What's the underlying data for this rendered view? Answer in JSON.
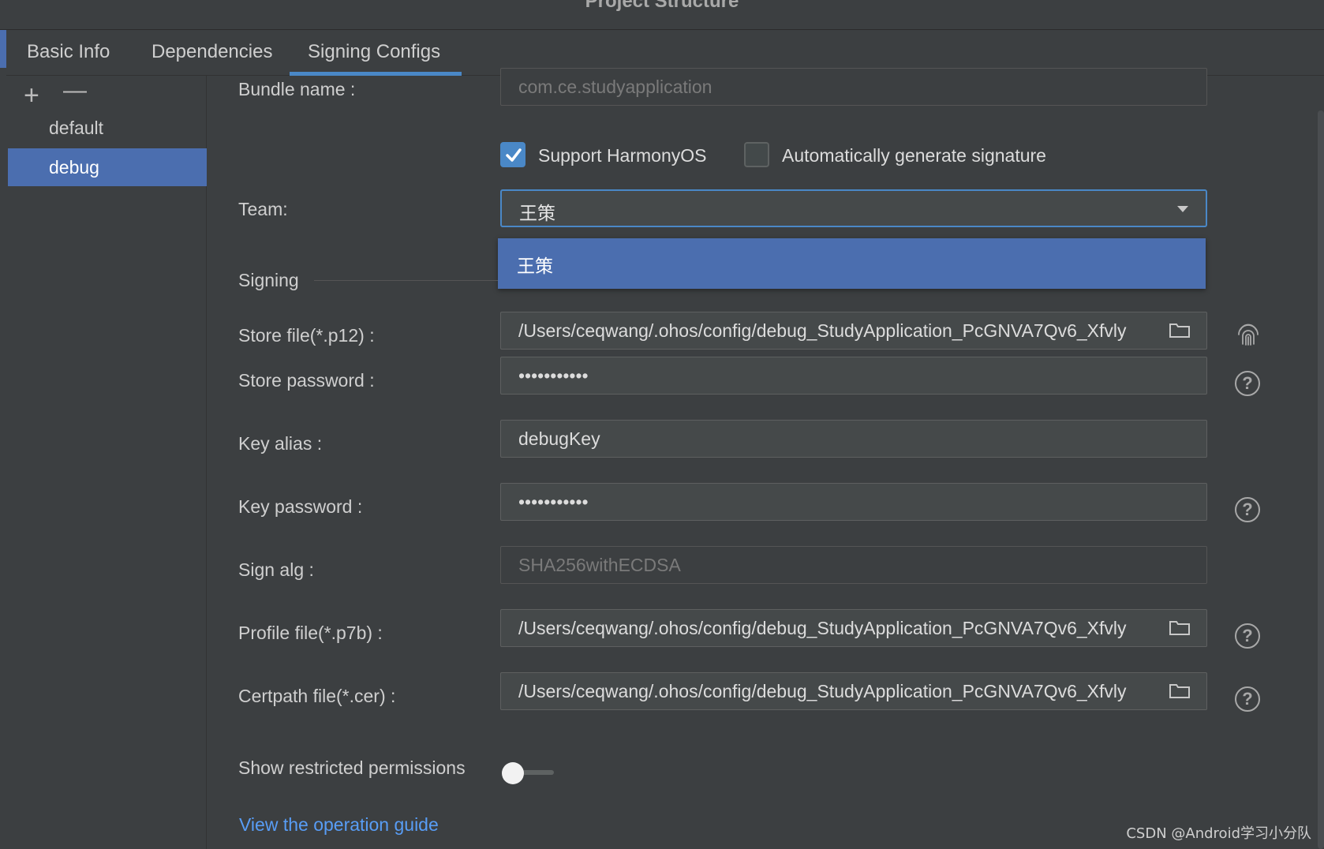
{
  "window": {
    "title": "Project Structure"
  },
  "tabs": [
    {
      "label": "Basic Info"
    },
    {
      "label": "Dependencies"
    },
    {
      "label": "Signing Configs"
    }
  ],
  "sidebar": {
    "add_symbol": "+",
    "remove_symbol": "—",
    "items": [
      {
        "label": "default"
      },
      {
        "label": "debug"
      }
    ],
    "selected": "debug"
  },
  "form": {
    "bundle_name": {
      "label": "Bundle name :",
      "value": "com.ce.studyapplication"
    },
    "support_harmonyos": {
      "label": "Support HarmonyOS",
      "checked": true
    },
    "auto_signature": {
      "label": "Automatically generate signature",
      "checked": false
    },
    "team": {
      "label": "Team:",
      "value": "王策",
      "options": [
        "王策"
      ]
    },
    "signing_section": "Signing",
    "store_file": {
      "label": "Store file(*.p12) :",
      "value": "/Users/ceqwang/.ohos/config/debug_StudyApplication_PcGNVA7Qv6_Xfvly"
    },
    "store_password": {
      "label": "Store password :",
      "value": "•••••••••••"
    },
    "key_alias": {
      "label": "Key alias :",
      "value": "debugKey"
    },
    "key_password": {
      "label": "Key password :",
      "value": "•••••••••••"
    },
    "sign_alg": {
      "label": "Sign alg :",
      "value": "SHA256withECDSA"
    },
    "profile_file": {
      "label": "Profile file(*.p7b) :",
      "value": "/Users/ceqwang/.ohos/config/debug_StudyApplication_PcGNVA7Qv6_Xfvly"
    },
    "certpath_file": {
      "label": "Certpath file(*.cer) :",
      "value": "/Users/ceqwang/.ohos/config/debug_StudyApplication_PcGNVA7Qv6_Xfvly"
    },
    "show_restricted": {
      "label": "Show restricted permissions",
      "on": false
    }
  },
  "links": {
    "operation_guide": "View the operation guide"
  },
  "icons": {
    "help": "?",
    "folder": "folder-icon",
    "fingerprint": "fingerprint-icon"
  },
  "watermark": "CSDN @Android学习小分队",
  "colors": {
    "accent": "#4a88c7",
    "selection": "#4b6eaf",
    "link": "#589df6",
    "background": "#3c3f41"
  }
}
